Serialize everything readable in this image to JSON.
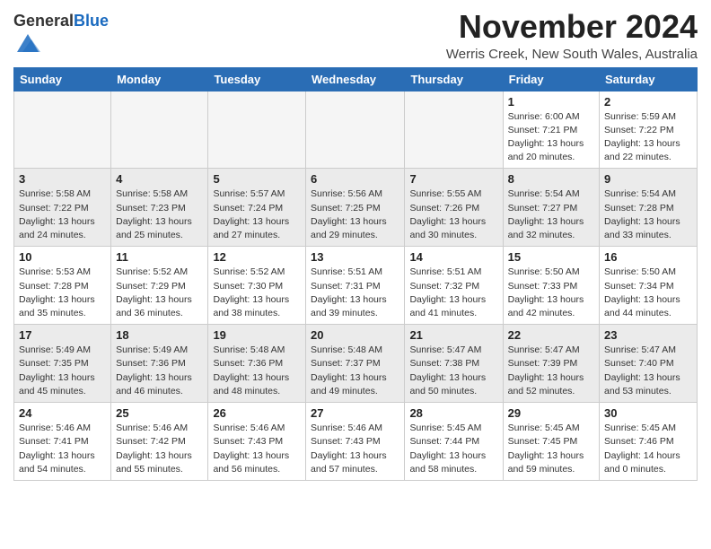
{
  "header": {
    "logo_general": "General",
    "logo_blue": "Blue",
    "month_title": "November 2024",
    "subtitle": "Werris Creek, New South Wales, Australia"
  },
  "columns": [
    "Sunday",
    "Monday",
    "Tuesday",
    "Wednesday",
    "Thursday",
    "Friday",
    "Saturday"
  ],
  "weeks": [
    {
      "shaded": false,
      "days": [
        {
          "date": "",
          "info": ""
        },
        {
          "date": "",
          "info": ""
        },
        {
          "date": "",
          "info": ""
        },
        {
          "date": "",
          "info": ""
        },
        {
          "date": "",
          "info": ""
        },
        {
          "date": "1",
          "info": "Sunrise: 6:00 AM\nSunset: 7:21 PM\nDaylight: 13 hours\nand 20 minutes."
        },
        {
          "date": "2",
          "info": "Sunrise: 5:59 AM\nSunset: 7:22 PM\nDaylight: 13 hours\nand 22 minutes."
        }
      ]
    },
    {
      "shaded": true,
      "days": [
        {
          "date": "3",
          "info": "Sunrise: 5:58 AM\nSunset: 7:22 PM\nDaylight: 13 hours\nand 24 minutes."
        },
        {
          "date": "4",
          "info": "Sunrise: 5:58 AM\nSunset: 7:23 PM\nDaylight: 13 hours\nand 25 minutes."
        },
        {
          "date": "5",
          "info": "Sunrise: 5:57 AM\nSunset: 7:24 PM\nDaylight: 13 hours\nand 27 minutes."
        },
        {
          "date": "6",
          "info": "Sunrise: 5:56 AM\nSunset: 7:25 PM\nDaylight: 13 hours\nand 29 minutes."
        },
        {
          "date": "7",
          "info": "Sunrise: 5:55 AM\nSunset: 7:26 PM\nDaylight: 13 hours\nand 30 minutes."
        },
        {
          "date": "8",
          "info": "Sunrise: 5:54 AM\nSunset: 7:27 PM\nDaylight: 13 hours\nand 32 minutes."
        },
        {
          "date": "9",
          "info": "Sunrise: 5:54 AM\nSunset: 7:28 PM\nDaylight: 13 hours\nand 33 minutes."
        }
      ]
    },
    {
      "shaded": false,
      "days": [
        {
          "date": "10",
          "info": "Sunrise: 5:53 AM\nSunset: 7:28 PM\nDaylight: 13 hours\nand 35 minutes."
        },
        {
          "date": "11",
          "info": "Sunrise: 5:52 AM\nSunset: 7:29 PM\nDaylight: 13 hours\nand 36 minutes."
        },
        {
          "date": "12",
          "info": "Sunrise: 5:52 AM\nSunset: 7:30 PM\nDaylight: 13 hours\nand 38 minutes."
        },
        {
          "date": "13",
          "info": "Sunrise: 5:51 AM\nSunset: 7:31 PM\nDaylight: 13 hours\nand 39 minutes."
        },
        {
          "date": "14",
          "info": "Sunrise: 5:51 AM\nSunset: 7:32 PM\nDaylight: 13 hours\nand 41 minutes."
        },
        {
          "date": "15",
          "info": "Sunrise: 5:50 AM\nSunset: 7:33 PM\nDaylight: 13 hours\nand 42 minutes."
        },
        {
          "date": "16",
          "info": "Sunrise: 5:50 AM\nSunset: 7:34 PM\nDaylight: 13 hours\nand 44 minutes."
        }
      ]
    },
    {
      "shaded": true,
      "days": [
        {
          "date": "17",
          "info": "Sunrise: 5:49 AM\nSunset: 7:35 PM\nDaylight: 13 hours\nand 45 minutes."
        },
        {
          "date": "18",
          "info": "Sunrise: 5:49 AM\nSunset: 7:36 PM\nDaylight: 13 hours\nand 46 minutes."
        },
        {
          "date": "19",
          "info": "Sunrise: 5:48 AM\nSunset: 7:36 PM\nDaylight: 13 hours\nand 48 minutes."
        },
        {
          "date": "20",
          "info": "Sunrise: 5:48 AM\nSunset: 7:37 PM\nDaylight: 13 hours\nand 49 minutes."
        },
        {
          "date": "21",
          "info": "Sunrise: 5:47 AM\nSunset: 7:38 PM\nDaylight: 13 hours\nand 50 minutes."
        },
        {
          "date": "22",
          "info": "Sunrise: 5:47 AM\nSunset: 7:39 PM\nDaylight: 13 hours\nand 52 minutes."
        },
        {
          "date": "23",
          "info": "Sunrise: 5:47 AM\nSunset: 7:40 PM\nDaylight: 13 hours\nand 53 minutes."
        }
      ]
    },
    {
      "shaded": false,
      "days": [
        {
          "date": "24",
          "info": "Sunrise: 5:46 AM\nSunset: 7:41 PM\nDaylight: 13 hours\nand 54 minutes."
        },
        {
          "date": "25",
          "info": "Sunrise: 5:46 AM\nSunset: 7:42 PM\nDaylight: 13 hours\nand 55 minutes."
        },
        {
          "date": "26",
          "info": "Sunrise: 5:46 AM\nSunset: 7:43 PM\nDaylight: 13 hours\nand 56 minutes."
        },
        {
          "date": "27",
          "info": "Sunrise: 5:46 AM\nSunset: 7:43 PM\nDaylight: 13 hours\nand 57 minutes."
        },
        {
          "date": "28",
          "info": "Sunrise: 5:45 AM\nSunset: 7:44 PM\nDaylight: 13 hours\nand 58 minutes."
        },
        {
          "date": "29",
          "info": "Sunrise: 5:45 AM\nSunset: 7:45 PM\nDaylight: 13 hours\nand 59 minutes."
        },
        {
          "date": "30",
          "info": "Sunrise: 5:45 AM\nSunset: 7:46 PM\nDaylight: 14 hours\nand 0 minutes."
        }
      ]
    }
  ]
}
